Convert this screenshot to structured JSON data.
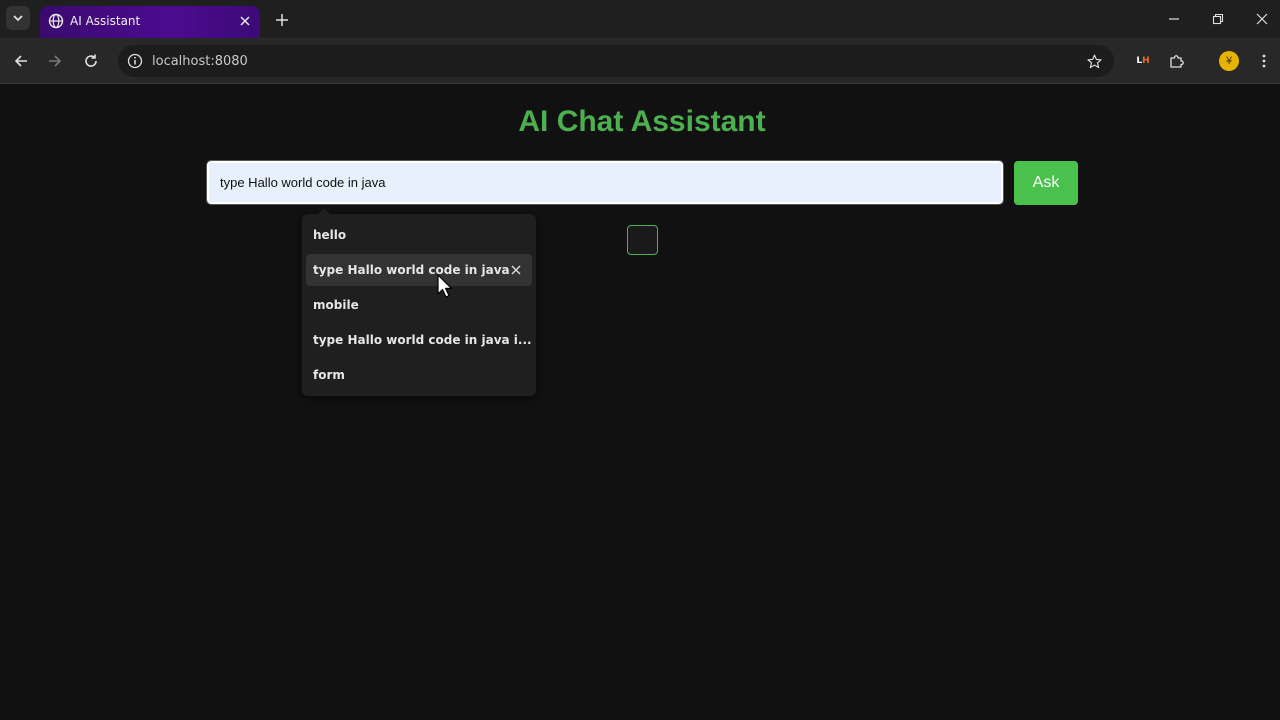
{
  "browser": {
    "tab": {
      "title": "AI Assistant",
      "favicon": "globe-icon",
      "close_icon": "close-icon"
    },
    "new_tab_icon": "plus-icon",
    "window_controls": [
      "minimize-icon",
      "restore-icon",
      "close-icon"
    ],
    "toolbar": {
      "back_icon": "back-arrow-icon",
      "forward_icon": "forward-arrow-icon",
      "reload_icon": "reload-icon",
      "site_info_icon": "info-icon",
      "url": "localhost:8080",
      "bookmark_icon": "star-icon",
      "extension_lighthouse": {
        "l": "L",
        "h": "H"
      },
      "extensions_icon": "puzzle-icon",
      "profile_initial": "¥",
      "menu_icon": "kebab-menu-icon"
    }
  },
  "page": {
    "title": "AI Chat Assistant",
    "input_value": "type Hallo world code in java",
    "ask_label": "Ask",
    "accent": "#4caf50"
  },
  "autofill": {
    "items": [
      {
        "label": "hello",
        "hover": false
      },
      {
        "label": "type Hallo world code in java",
        "hover": true
      },
      {
        "label": "mobile",
        "hover": false
      },
      {
        "label": "type Hallo world code in java i...",
        "hover": false
      },
      {
        "label": "form",
        "hover": false
      }
    ],
    "remove_icon": "close-icon"
  }
}
